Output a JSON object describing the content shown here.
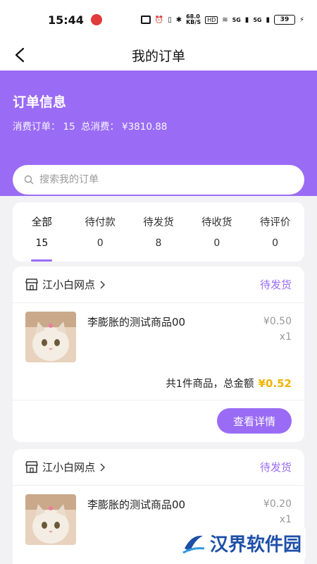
{
  "status_bar": {
    "time": "15:44",
    "net_speed": "68.0\nKB/S",
    "hd": "HD",
    "signal_5g_1": "5G",
    "signal_5g_2": "5G",
    "battery": "39"
  },
  "header": {
    "title": "我的订单"
  },
  "summary": {
    "title": "订单信息",
    "orders_label": "消费订单：",
    "orders_value": "15",
    "spend_label": "总消费：",
    "spend_value": "¥3810.88"
  },
  "search": {
    "placeholder": "搜索我的订单"
  },
  "tabs": [
    {
      "label": "全部",
      "count": "15"
    },
    {
      "label": "待付款",
      "count": "0"
    },
    {
      "label": "待发货",
      "count": "8"
    },
    {
      "label": "待收货",
      "count": "0"
    },
    {
      "label": "待评价",
      "count": "0"
    }
  ],
  "orders": [
    {
      "shop": "江小白网点",
      "status": "待发货",
      "product": "李膨胀的测试商品00",
      "price": "¥0.50",
      "qty": "x1",
      "total_text": "共1件商品，总金额",
      "total_amount": "¥0.52",
      "button": "查看详情"
    },
    {
      "shop": "江小白网点",
      "status": "待发货",
      "product": "李膨胀的测试商品00",
      "price": "¥0.20",
      "qty": "x1"
    }
  ],
  "watermark": {
    "text": "汉界软件园"
  },
  "colors": {
    "accent": "#9a6cf5",
    "amount": "#f0b400"
  }
}
